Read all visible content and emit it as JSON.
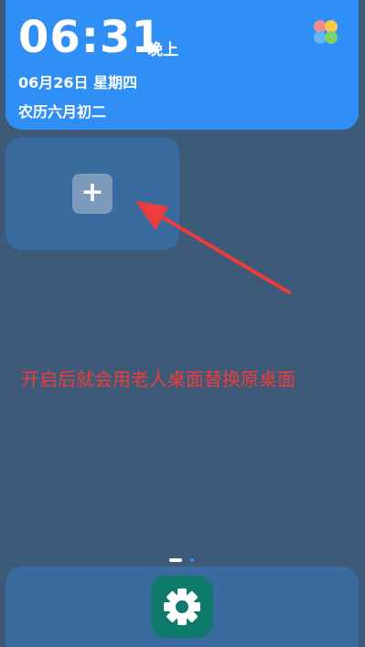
{
  "clock": {
    "time": "06:31",
    "period": "晚上",
    "date": "06月26日  星期四",
    "lunar": "农历六月初二"
  },
  "widget_slot": {
    "add_symbol": "+"
  },
  "annotation": {
    "text": "开启后就会用老人桌面替换原桌面",
    "color": "#ee3b3b"
  },
  "page_indicator": {
    "current": 1,
    "total": 2
  },
  "dock": {
    "apps": [
      {
        "icon": "gear-icon",
        "color": "#0f7a6b"
      }
    ]
  },
  "colors": {
    "background": "#3d5a79",
    "clock_card": "#2f8ff4",
    "slot": "#3a6b9e"
  }
}
